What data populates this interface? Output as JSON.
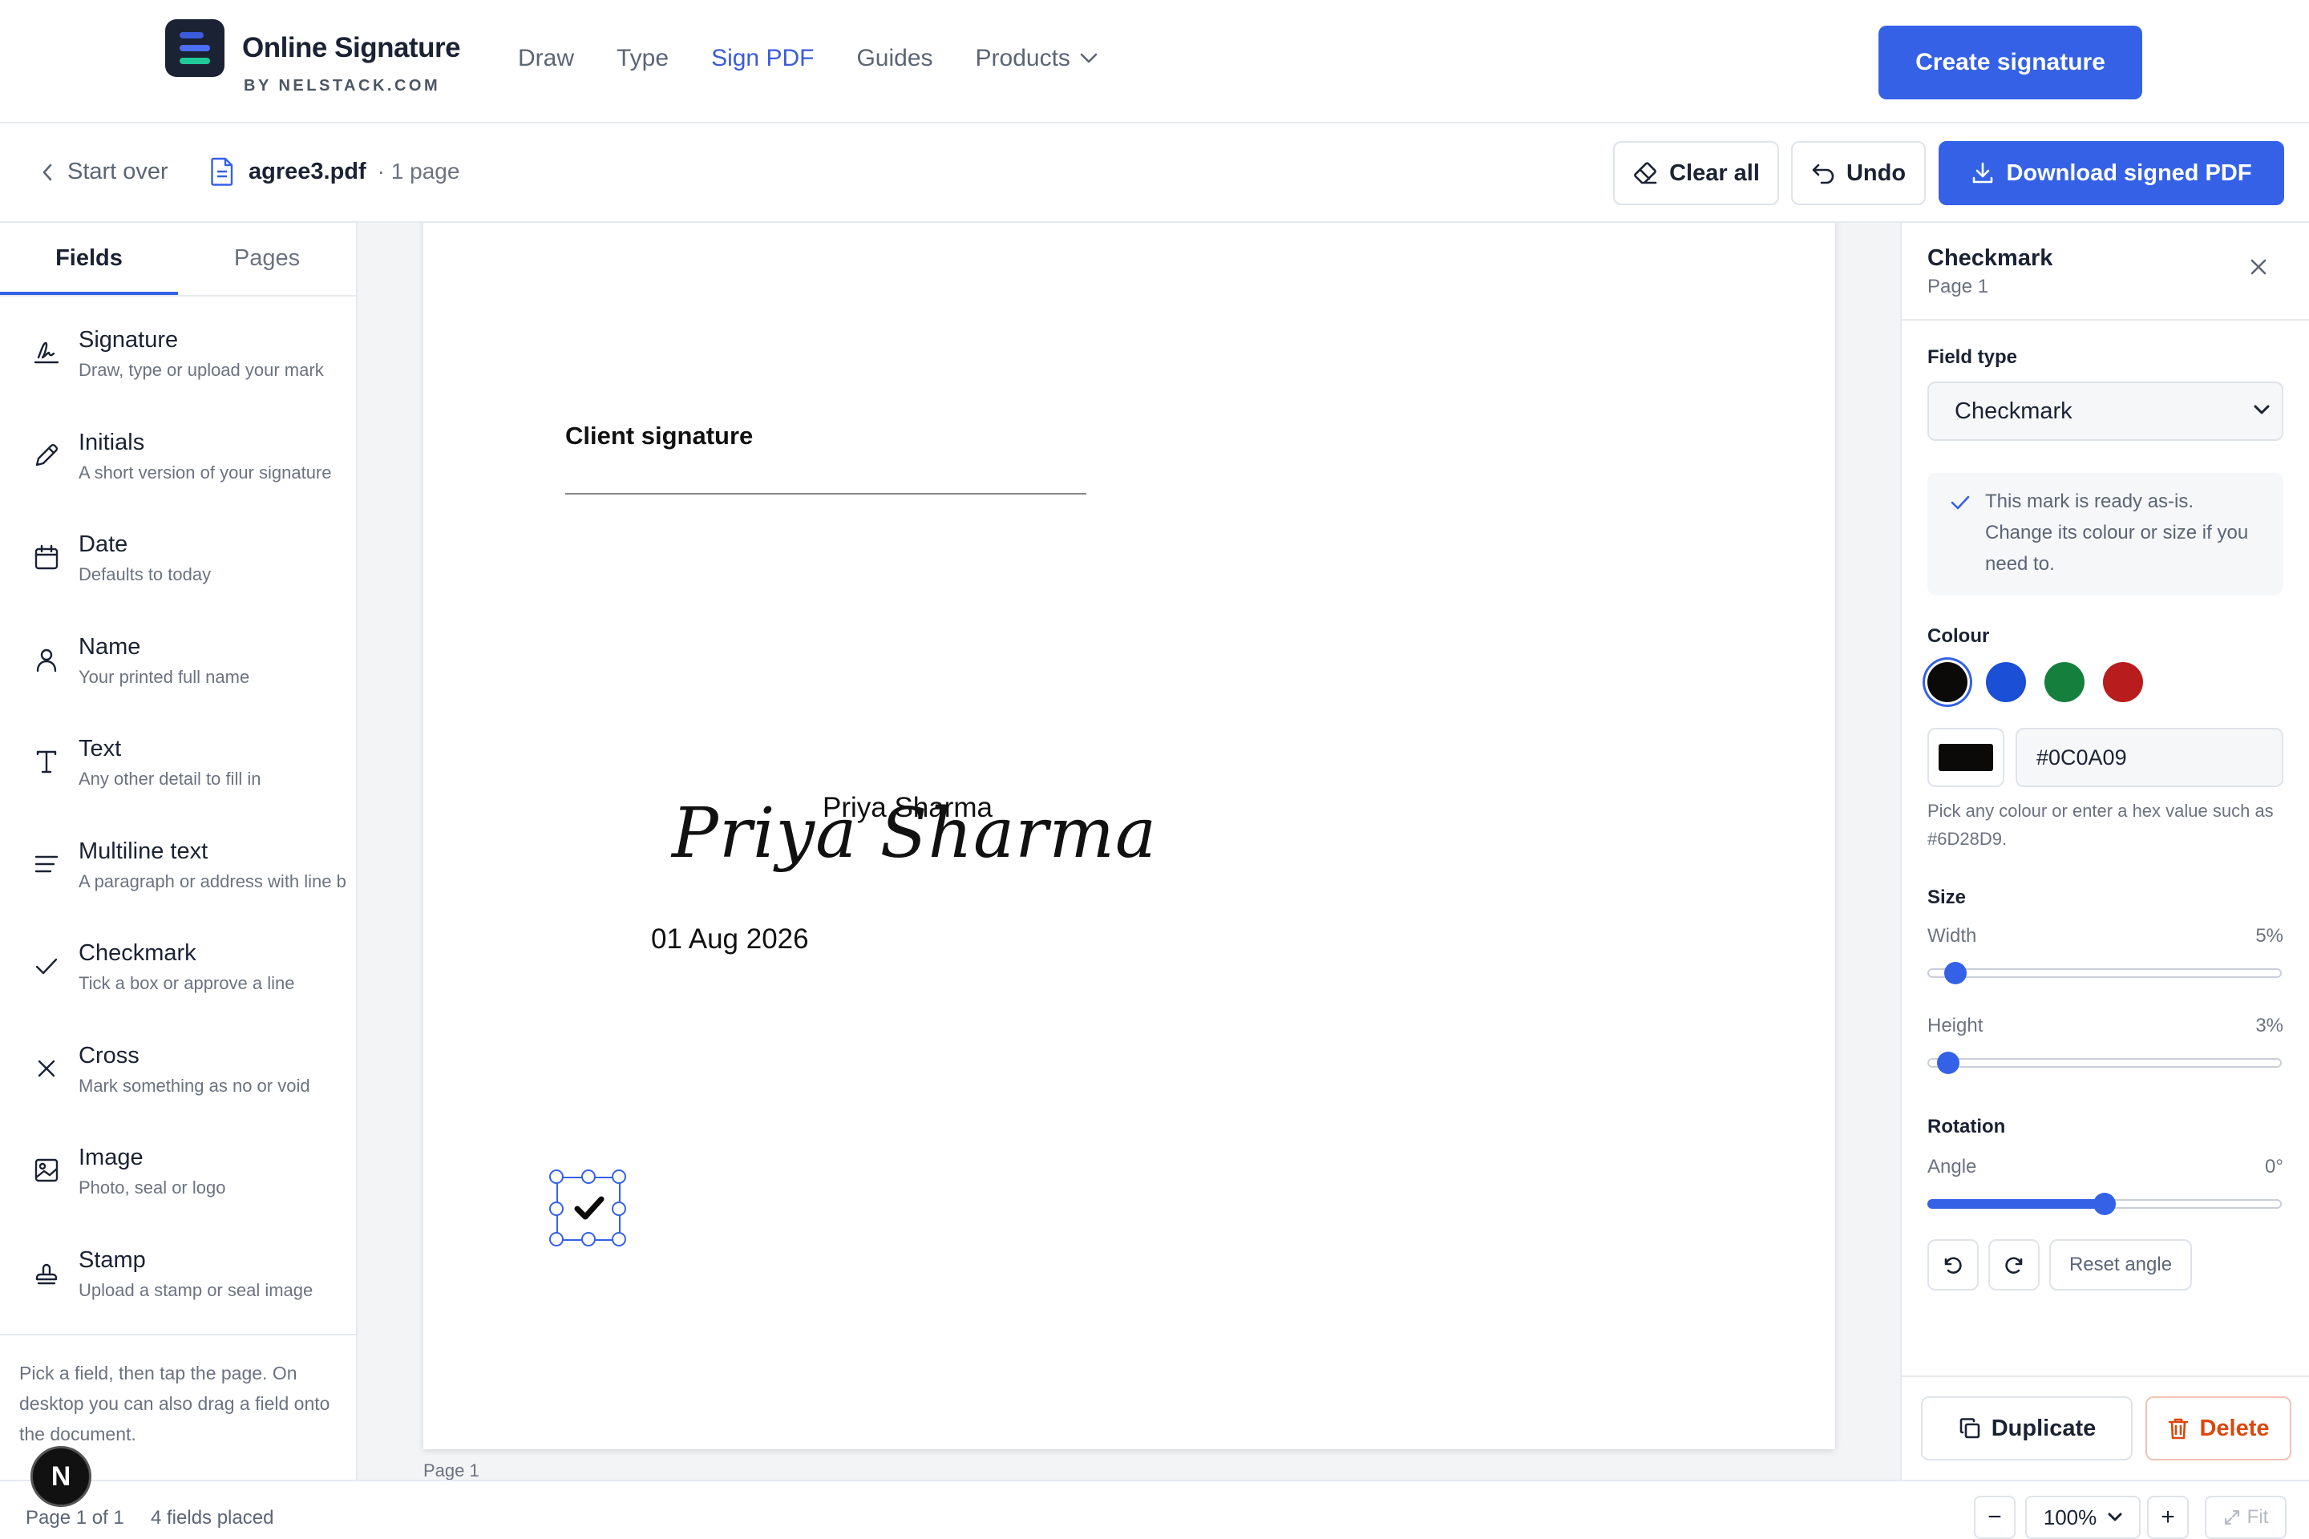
{
  "brand": {
    "name": "Online Signature",
    "sub": "BY NELSTACK.COM",
    "logo_colors": [
      "#3b5bdb",
      "#4c6ef5",
      "#20c997"
    ]
  },
  "nav": {
    "items": [
      {
        "label": "Draw",
        "active": false
      },
      {
        "label": "Type",
        "active": false
      },
      {
        "label": "Sign PDF",
        "active": true
      },
      {
        "label": "Guides",
        "active": false
      },
      {
        "label": "Products",
        "active": false,
        "has_dropdown": true
      }
    ],
    "cta_label": "Create signature"
  },
  "toolbar": {
    "start_over": "Start over",
    "file_name": "agree3.pdf",
    "page_count": "· 1 page",
    "clear_all": "Clear all",
    "undo": "Undo",
    "download": "Download signed PDF"
  },
  "sidebar": {
    "tabs": [
      {
        "label": "Fields",
        "active": true
      },
      {
        "label": "Pages",
        "active": false
      }
    ],
    "fields": [
      {
        "icon": "signature-icon",
        "title": "Signature",
        "desc": "Draw, type or upload your mark"
      },
      {
        "icon": "pen-icon",
        "title": "Initials",
        "desc": "A short version of your signature"
      },
      {
        "icon": "calendar-icon",
        "title": "Date",
        "desc": "Defaults to today"
      },
      {
        "icon": "person-icon",
        "title": "Name",
        "desc": "Your printed full name"
      },
      {
        "icon": "text-icon",
        "title": "Text",
        "desc": "Any other detail to fill in"
      },
      {
        "icon": "lines-icon",
        "title": "Multiline text",
        "desc": "A paragraph or address with line b"
      },
      {
        "icon": "check-icon",
        "title": "Checkmark",
        "desc": "Tick a box or approve a line"
      },
      {
        "icon": "cross-icon",
        "title": "Cross",
        "desc": "Mark something as no or void"
      },
      {
        "icon": "image-icon",
        "title": "Image",
        "desc": "Photo, seal or logo"
      },
      {
        "icon": "stamp-icon",
        "title": "Stamp",
        "desc": "Upload a stamp or seal image"
      }
    ],
    "hint": "Pick a field, then tap the page. On desktop you can also drag a field onto the document."
  },
  "document": {
    "heading": "Client signature",
    "typed_name": "Priya Sharma",
    "script_signature": "Priya Sharma",
    "date": "01 Aug 2026",
    "page_label": "Page 1"
  },
  "panel": {
    "title": "Checkmark",
    "subtitle": "Page 1",
    "field_type_label": "Field type",
    "field_type_value": "Checkmark",
    "note": "This mark is ready as-is. Change its colour or size if you need to.",
    "colour_label": "Colour",
    "swatches": [
      "#0c0a09",
      "#1a4fd6",
      "#15803d",
      "#b91c1c"
    ],
    "selected_swatch": "#0c0a09",
    "hex_value": "#0C0A09",
    "colour_hint": "Pick any colour or enter a hex value such as #6D28D9.",
    "size_label": "Size",
    "width_label": "Width",
    "width_value": "5%",
    "width_fraction": 0.05,
    "height_label": "Height",
    "height_value": "3%",
    "height_fraction": 0.03,
    "rotation_label": "Rotation",
    "angle_label": "Angle",
    "angle_value": "0°",
    "angle_fraction": 0.5,
    "reset_angle": "Reset angle",
    "duplicate": "Duplicate",
    "delete": "Delete"
  },
  "status": {
    "page_info": "Page 1 of 1",
    "fields_placed": "4 fields placed",
    "zoom": "100%",
    "zoom_out": "−",
    "zoom_in": "+",
    "fit": "Fit"
  },
  "fab": {
    "label": "N"
  }
}
